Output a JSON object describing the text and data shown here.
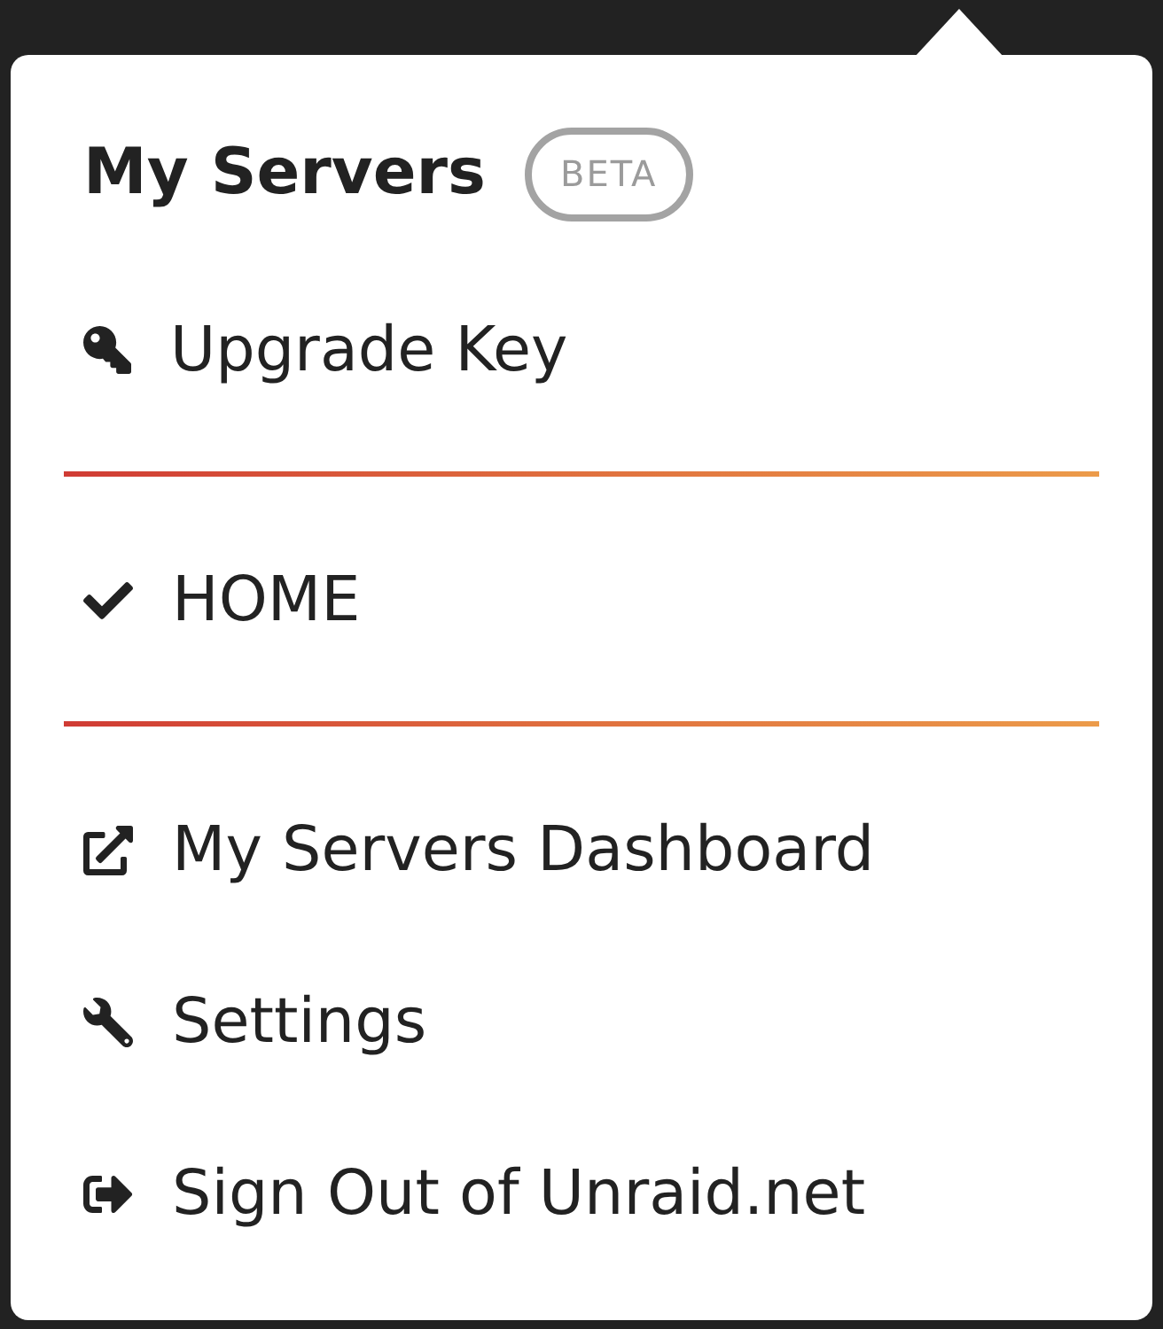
{
  "popover": {
    "title": "My Servers",
    "badge": "BETA"
  },
  "actions_top": [
    {
      "kind": "upgrade",
      "label": "Upgrade Key"
    }
  ],
  "servers": [
    {
      "label": "HOME",
      "selected": true
    }
  ],
  "actions_bottom": [
    {
      "kind": "dashboard",
      "label": "My Servers Dashboard"
    },
    {
      "kind": "settings",
      "label": "Settings"
    },
    {
      "kind": "signout",
      "label": "Sign Out of Unraid.net"
    }
  ]
}
